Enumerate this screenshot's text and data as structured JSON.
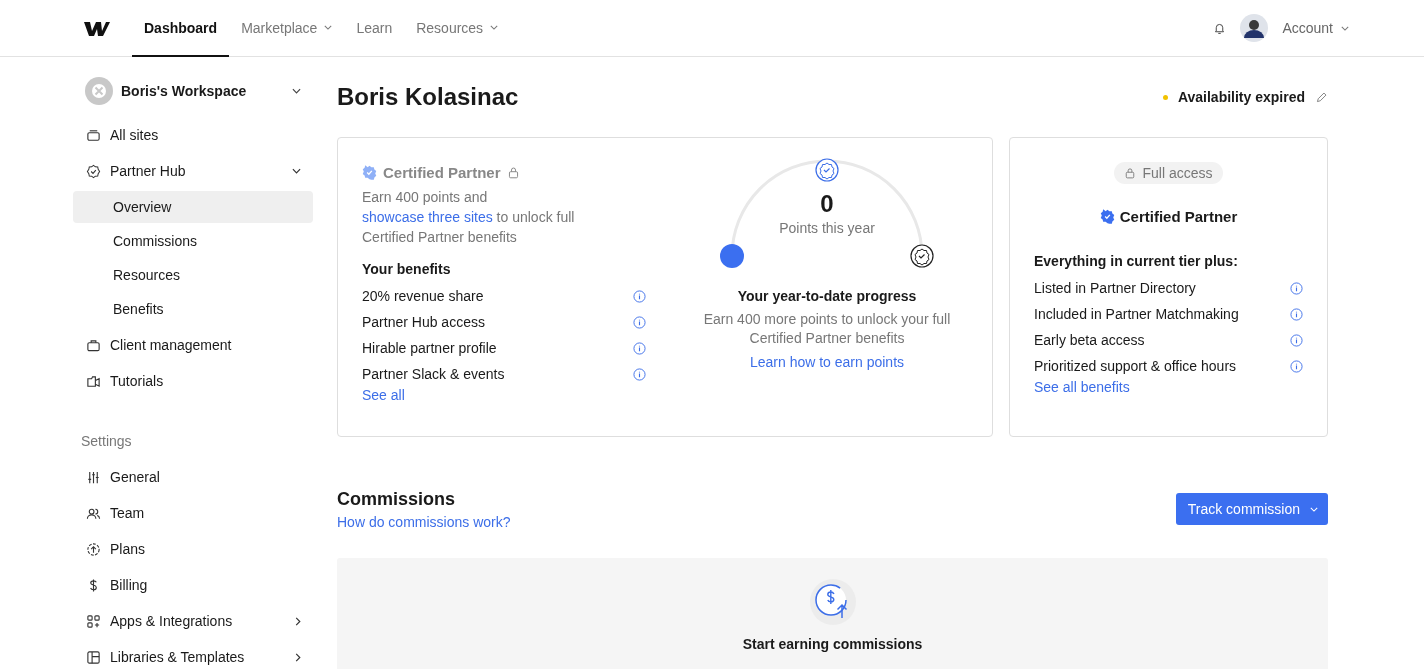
{
  "top_nav": {
    "tabs": [
      {
        "label": "Dashboard",
        "selected": true,
        "dropdown": false
      },
      {
        "label": "Marketplace",
        "selected": false,
        "dropdown": true
      },
      {
        "label": "Learn",
        "selected": false,
        "dropdown": false
      },
      {
        "label": "Resources",
        "selected": false,
        "dropdown": true
      }
    ],
    "account": {
      "label": "Account"
    }
  },
  "sidebar": {
    "workspace": "Boris's Workspace",
    "items": [
      {
        "label": "All sites"
      },
      {
        "label": "Partner Hub",
        "expanded": true,
        "children": [
          {
            "label": "Overview",
            "selected": true
          },
          {
            "label": "Commissions",
            "selected": false
          },
          {
            "label": "Resources",
            "selected": false
          },
          {
            "label": "Benefits",
            "selected": false
          }
        ]
      },
      {
        "label": "Client management"
      },
      {
        "label": "Tutorials"
      }
    ],
    "settings_heading": "Settings",
    "settings_items": [
      {
        "label": "General",
        "submenu": false
      },
      {
        "label": "Team",
        "submenu": false
      },
      {
        "label": "Plans",
        "submenu": false
      },
      {
        "label": "Billing",
        "submenu": false
      },
      {
        "label": "Apps & Integrations",
        "submenu": true
      },
      {
        "label": "Libraries & Templates",
        "submenu": true
      }
    ]
  },
  "page": {
    "title": "Boris Kolasinac",
    "availability": "Availability expired"
  },
  "current_tier": {
    "title": "Certified Partner",
    "locked": true,
    "description": {
      "before": "Earn 400 points and ",
      "link": "showcase three sites",
      "after": " to unlock full Certified Partner benefits"
    },
    "benefits_heading": "Your benefits",
    "benefits": [
      "20% revenue share",
      "Partner Hub access",
      "Hirable partner profile",
      "Partner Slack & events"
    ],
    "see_all": "See all"
  },
  "progress": {
    "points": "0",
    "points_label": "Points this year",
    "level": 0,
    "heading": "Your year-to-date progress",
    "text": "Earn 400 more points to unlock your full Certified Partner benefits",
    "link": "Learn how to earn points"
  },
  "next_tier": {
    "badge": "Full access",
    "title": "Certified Partner",
    "benefits_heading": "Everything in current tier plus:",
    "benefits": [
      "Listed in Partner Directory",
      "Included in Partner Matchmaking",
      "Early beta access",
      "Prioritized support & office hours"
    ],
    "see_all": "See all benefits"
  },
  "commissions": {
    "title": "Commissions",
    "help_link": "How do commissions work?",
    "button": "Track commission",
    "empty_title": "Start earning commissions"
  }
}
